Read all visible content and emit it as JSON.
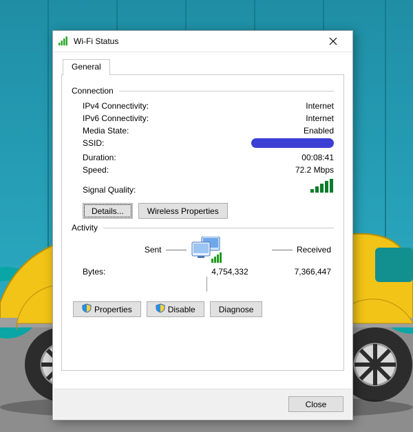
{
  "window": {
    "title": "Wi-Fi Status"
  },
  "tab": {
    "general": "General"
  },
  "groups": {
    "connection": "Connection",
    "activity": "Activity"
  },
  "conn": {
    "ipv4_k": "IPv4 Connectivity:",
    "ipv4_v": "Internet",
    "ipv6_k": "IPv6 Connectivity:",
    "ipv6_v": "Internet",
    "media_k": "Media State:",
    "media_v": "Enabled",
    "ssid_k": "SSID:",
    "dur_k": "Duration:",
    "dur_v": "00:08:41",
    "speed_k": "Speed:",
    "speed_v": "72.2 Mbps",
    "sig_k": "Signal Quality:"
  },
  "buttons": {
    "details": "Details...",
    "wprops": "Wireless Properties",
    "properties": "Properties",
    "disable": "Disable",
    "diagnose": "Diagnose",
    "close": "Close"
  },
  "activity": {
    "sent": "Sent",
    "received": "Received",
    "bytes_label": "Bytes:",
    "bytes_sent": "4,754,332",
    "bytes_recv": "7,366,447"
  },
  "icons": {
    "wifi": "wifi-icon",
    "close": "close-icon",
    "shield": "shield-icon",
    "monitors": "monitors-icon",
    "signal": "signal-bars-icon"
  }
}
